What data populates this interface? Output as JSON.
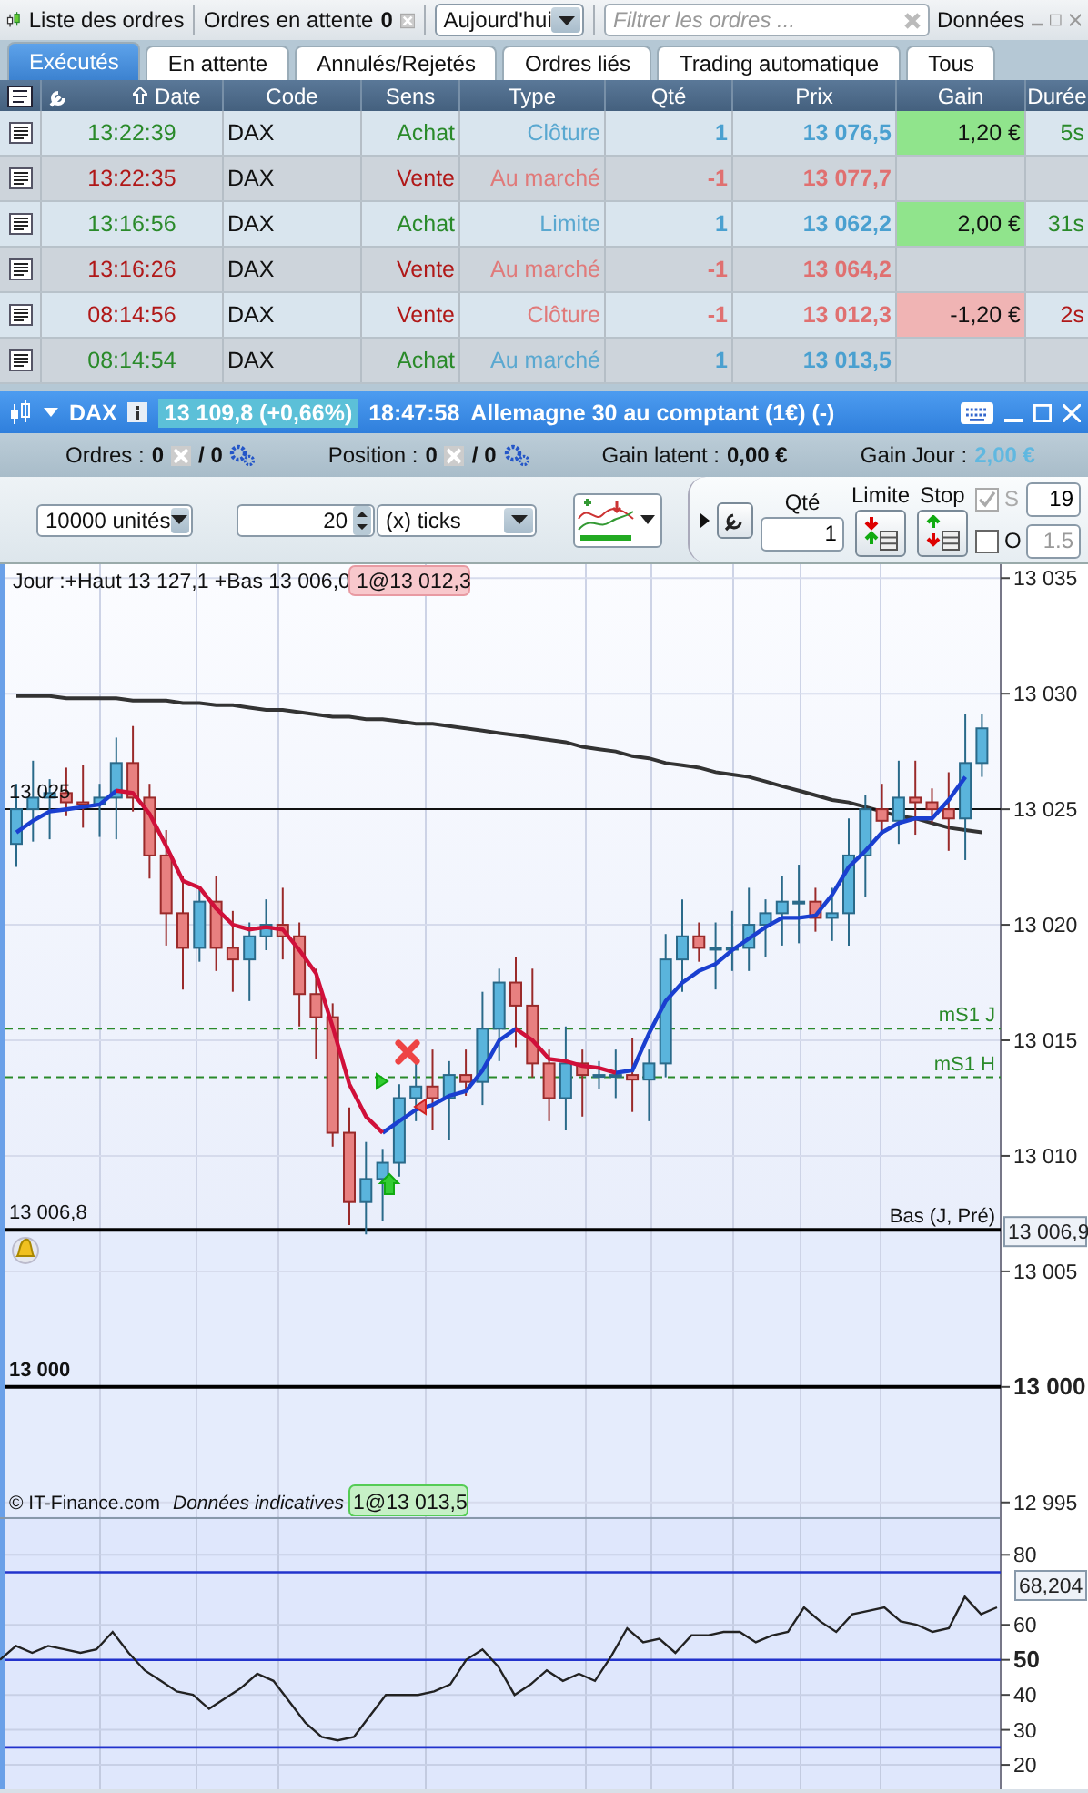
{
  "order_list": {
    "title": "Liste des ordres",
    "pending_label": "Ordres en attente",
    "pending_count": "0",
    "period": "Aujourd'hui",
    "filter": {
      "placeholder": "Filtrer les ordres ..."
    },
    "data_label": "Données",
    "tabs": [
      {
        "label": "Exécutés",
        "selected": true
      },
      {
        "label": "En attente",
        "selected": false
      },
      {
        "label": "Annulés/Rejetés",
        "selected": false
      },
      {
        "label": "Ordres liés",
        "selected": false
      },
      {
        "label": "Trading automatique",
        "selected": false
      },
      {
        "label": "Tous",
        "selected": false
      }
    ],
    "columns": [
      "Date",
      "Code",
      "Sens",
      "Type",
      "Qté",
      "Prix",
      "Gain",
      "Durée"
    ],
    "rows": [
      {
        "kind": "buy",
        "date": "13:22:39",
        "code": "DAX",
        "side": "Achat",
        "type": "Clôture",
        "qty": "1",
        "price": "13 076,5",
        "gain": "1,20 €",
        "gain_positive": true,
        "duration": "5s"
      },
      {
        "kind": "sell",
        "date": "13:22:35",
        "code": "DAX",
        "side": "Vente",
        "type": "Au marché",
        "qty": "-1",
        "price": "13 077,7"
      },
      {
        "kind": "buy",
        "date": "13:16:56",
        "code": "DAX",
        "side": "Achat",
        "type": "Limite",
        "qty": "1",
        "price": "13 062,2",
        "gain": "2,00 €",
        "gain_positive": true,
        "duration": "31s"
      },
      {
        "kind": "sell",
        "date": "13:16:26",
        "code": "DAX",
        "side": "Vente",
        "type": "Au marché",
        "qty": "-1",
        "price": "13 064,2"
      },
      {
        "kind": "sell",
        "date": "08:14:56",
        "code": "DAX",
        "side": "Vente",
        "type": "Clôture",
        "qty": "-1",
        "price": "13 012,3",
        "gain": "-1,20 €",
        "gain_positive": false,
        "duration": "2s"
      },
      {
        "kind": "buy",
        "date": "08:14:54",
        "code": "DAX",
        "side": "Achat",
        "type": "Au marché",
        "qty": "1",
        "price": "13 013,5"
      }
    ]
  },
  "chart_window": {
    "symbol": "DAX",
    "quote": "13 109,8 (+0,66%)",
    "time": "18:47:58",
    "instrument": "Allemagne 30 au comptant (1€) (-)"
  },
  "position_bar": {
    "orders_label": "Ordres :",
    "orders_count": "0",
    "orders_auto": "/ 0",
    "position_label": "Position :",
    "position_count": "0",
    "position_auto": "/ 0",
    "unrealized_label": "Gain latent :",
    "unrealized_value": "0,00 €",
    "day_gain_label": "Gain Jour :",
    "day_gain_value": "2,00 €"
  },
  "toolbar": {
    "units": "10000 unités",
    "step": "20",
    "step_unit": "(x) ticks",
    "qty_label": "Qté",
    "qty": "1",
    "limit_label": "Limite",
    "stop_label": "Stop",
    "s_label": "S",
    "s_checked": true,
    "s_value": "19",
    "o_label": "O",
    "o_checked": false,
    "o_value": "1.5"
  },
  "price_chart": {
    "header": "Jour :+Haut 13 127,1 +Bas 13 006,0",
    "sell_tag": "1@13 012,3",
    "buy_tag": "1@13 013,5",
    "current_price": "13 006,9",
    "low_line_name": "Bas (J, Pré)",
    "copyright": "© IT-Finance.com",
    "disclaimer": "Données indicatives",
    "chart_data": {
      "type": "candlestick",
      "grid": true,
      "ylim": [
        12994.4,
        13035.6
      ],
      "yticks": [
        {
          "value": 13035,
          "label": "13 035"
        },
        {
          "value": 13030,
          "label": "13 030"
        },
        {
          "value": 13025,
          "label": "13 025"
        },
        {
          "value": 13020,
          "label": "13 020"
        },
        {
          "value": 13015,
          "label": "13 015"
        },
        {
          "value": 13010,
          "label": "13 010"
        },
        {
          "value": 13005,
          "label": "13 005"
        },
        {
          "value": 13000,
          "label": "13 000"
        },
        {
          "value": 12995,
          "label": "12 995"
        }
      ],
      "ohlc": [
        [
          13023.5,
          13026.1,
          13022.5,
          13025
        ],
        [
          13025,
          13027.1,
          13023.6,
          13025.5
        ],
        [
          13025.5,
          13026.3,
          13023.7,
          13025.7
        ],
        [
          13025.7,
          13026.8,
          13024.7,
          13025.3
        ],
        [
          13025.3,
          13026.9,
          13024.2,
          13025.2
        ],
        [
          13025.2,
          13026.1,
          13023.8,
          13025.5
        ],
        [
          13025.5,
          13028.1,
          13023.7,
          13027
        ],
        [
          13027,
          13028.6,
          13024.9,
          13025.5
        ],
        [
          13025.5,
          13026.1,
          13022,
          13023
        ],
        [
          13023,
          13024.1,
          13019.1,
          13020.5
        ],
        [
          13020.5,
          13022.1,
          13017.2,
          13019
        ],
        [
          13019,
          13021.6,
          13018.4,
          13021
        ],
        [
          13021,
          13022.1,
          13018,
          13019
        ],
        [
          13019,
          13020.6,
          13017.1,
          13018.5
        ],
        [
          13018.5,
          13020.1,
          13016.7,
          13019.5
        ],
        [
          13019.5,
          13021.1,
          13018.9,
          13020
        ],
        [
          13020,
          13021.6,
          13018.5,
          13019.5
        ],
        [
          13019.5,
          13020.1,
          13015.6,
          13017
        ],
        [
          13017,
          13018.1,
          13014.2,
          13016
        ],
        [
          13016,
          13016.6,
          13010.4,
          13011
        ],
        [
          13011,
          13012.1,
          13007,
          13008
        ],
        [
          13008,
          13010.6,
          13006.6,
          13009
        ],
        [
          13009,
          13010.3,
          13007.2,
          13009.7
        ],
        [
          13009.7,
          13013.1,
          13009.1,
          13012.5
        ],
        [
          13012.5,
          13014.1,
          13011.5,
          13013
        ],
        [
          13013,
          13014.6,
          13011.1,
          13012.5
        ],
        [
          13012.5,
          13014.1,
          13010.7,
          13013.5
        ],
        [
          13013.5,
          13014.6,
          13012.6,
          13013.2
        ],
        [
          13013.2,
          13017.1,
          13012.2,
          13015.5
        ],
        [
          13015.5,
          13018.1,
          13014.1,
          13017.5
        ],
        [
          13017.5,
          13018.6,
          13014.7,
          13016.5
        ],
        [
          13016.5,
          13018.1,
          13013.4,
          13014
        ],
        [
          13014,
          13014.6,
          13011.5,
          13012.5
        ],
        [
          13012.5,
          13015.6,
          13011.1,
          13014
        ],
        [
          13014,
          13014.6,
          13011.7,
          13013.5
        ],
        [
          13013.5,
          13014.1,
          13012.9,
          13013.5
        ],
        [
          13013.5,
          13014.6,
          13012.5,
          13013.5
        ],
        [
          13013.5,
          13015.1,
          13011.9,
          13013.3
        ],
        [
          13013.3,
          13014.6,
          13011.5,
          13014
        ],
        [
          13014,
          13019.6,
          13013.4,
          13018.5
        ],
        [
          13018.5,
          13021.1,
          13017.1,
          13019.5
        ],
        [
          13019.5,
          13020.1,
          13018.4,
          13019
        ],
        [
          13019,
          13020.1,
          13017.2,
          13019
        ],
        [
          13019,
          13020.6,
          13018,
          13019
        ],
        [
          13019,
          13021.6,
          13018,
          13020
        ],
        [
          13020,
          13021.1,
          13018.6,
          13020.5
        ],
        [
          13020.5,
          13022.1,
          13019.1,
          13021
        ],
        [
          13021,
          13022.6,
          13019.2,
          13021
        ],
        [
          13021,
          13021.6,
          13019.7,
          13020.3
        ],
        [
          13020.3,
          13021.6,
          13019.3,
          13020.5
        ],
        [
          13020.5,
          13024.6,
          13019.1,
          13023
        ],
        [
          13023,
          13025.6,
          13021.2,
          13025
        ],
        [
          13025,
          13026.1,
          13023.9,
          13024.5
        ],
        [
          13024.5,
          13027.1,
          13023.5,
          13025.5
        ],
        [
          13025.5,
          13027.1,
          13023.9,
          13025.3
        ],
        [
          13025.3,
          13025.9,
          13024.4,
          13025
        ],
        [
          13025,
          13026.6,
          13023.2,
          13024.6
        ],
        [
          13024.6,
          13029.1,
          13022.8,
          13027
        ],
        [
          13027,
          13029.1,
          13026.4,
          13028.5
        ]
      ],
      "series": [
        {
          "type": "line",
          "color": "#333333",
          "values": [
            13029.9,
            13029.9,
            13029.9,
            13029.8,
            13029.8,
            13029.8,
            13029.8,
            13029.7,
            13029.7,
            13029.7,
            13029.6,
            13029.6,
            13029.5,
            13029.5,
            13029.4,
            13029.3,
            13029.3,
            13029.2,
            13029.1,
            13029.0,
            13029.0,
            13028.9,
            13028.9,
            13028.8,
            13028.7,
            13028.7,
            13028.6,
            13028.5,
            13028.4,
            13028.3,
            13028.2,
            13028.1,
            13028.0,
            13027.9,
            13027.7,
            13027.6,
            13027.5,
            13027.3,
            13027.2,
            13027.0,
            13026.9,
            13026.8,
            13026.6,
            13026.5,
            13026.4,
            13026.2,
            13026.0,
            13025.8,
            13025.6,
            13025.4,
            13025.3,
            13025.1,
            13024.9,
            13024.7,
            13024.6,
            13024.4,
            13024.2,
            13024.1,
            13024.0
          ]
        },
        {
          "type": "line",
          "color": "#1a3fd0",
          "values": [
            13024.0,
            13024.5,
            13024.9,
            13025.0,
            13025.1,
            13025.2,
            13025.8,
            null,
            null,
            null,
            null,
            null,
            null,
            null,
            null,
            null,
            null,
            null,
            null,
            null,
            null,
            null,
            13011.0,
            13011.5,
            13012.0,
            13012.2,
            13012.6,
            13012.8,
            13013.7,
            13015.0,
            13015.5,
            null,
            null,
            null,
            null,
            null,
            13013.6,
            13013.7,
            13015.3,
            13016.7,
            13017.5,
            13018.0,
            13018.3,
            13018.9,
            13019.4,
            13019.9,
            13020.3,
            13020.3,
            13020.4,
            13021.3,
            13022.5,
            13023.2,
            13024.0,
            13024.4,
            13024.6,
            13024.6,
            13025.4,
            13026.4,
            null
          ]
        },
        {
          "type": "line",
          "color": "#d0103a",
          "values": [
            null,
            null,
            null,
            null,
            null,
            null,
            13025.8,
            13025.7,
            13024.8,
            13023.4,
            13021.9,
            13021.6,
            13020.7,
            13020.0,
            13019.8,
            13019.9,
            13019.8,
            13018.9,
            13017.9,
            13015.6,
            13013.1,
            13011.7,
            13011.0,
            null,
            null,
            null,
            null,
            null,
            null,
            null,
            13015.5,
            13015.0,
            13014.2,
            13014.1,
            13013.9,
            13013.8,
            13013.6,
            null,
            null,
            null,
            null,
            null,
            null,
            null,
            null,
            null,
            null,
            null,
            null,
            null,
            null,
            null,
            null,
            null,
            null,
            null,
            null,
            null,
            null
          ]
        }
      ],
      "ref_lines": [
        {
          "axis": "y",
          "value": 13025,
          "label": "13 025",
          "color": "#111111"
        },
        {
          "axis": "y",
          "value": 13015.5,
          "label": "mS1 J",
          "color": "#2a8a2a"
        },
        {
          "axis": "y",
          "value": 13013.4,
          "label": "mS1 H",
          "color": "#2a8a2a"
        },
        {
          "axis": "y",
          "value": 13006.8,
          "label": "13 006,8",
          "color": "#000000"
        },
        {
          "axis": "y",
          "value": 13000,
          "label": "13 000",
          "color": "#000000"
        }
      ]
    }
  },
  "oscillator": {
    "current_value": "68,204",
    "chart_data": {
      "type": "line",
      "grid": true,
      "ylim": [
        13,
        91
      ],
      "yticks": [
        20,
        30,
        40,
        50,
        60,
        80
      ],
      "series": [
        {
          "color": "#222222",
          "values": [
            50,
            54,
            52,
            54,
            53,
            52,
            53,
            58,
            52,
            47,
            44,
            41,
            40,
            36,
            39,
            42,
            46,
            44,
            38,
            32,
            28,
            27,
            28,
            34,
            40,
            40,
            40,
            41,
            43,
            50,
            53,
            48,
            40,
            43,
            47,
            44,
            46,
            44,
            51,
            59,
            55,
            56,
            52,
            57,
            57,
            58,
            58,
            55,
            57,
            58,
            65,
            61,
            58,
            63,
            64,
            65,
            61,
            60,
            58,
            59,
            68,
            63,
            65
          ]
        }
      ],
      "ref_lines": [
        {
          "axis": "y",
          "value": 75,
          "color": "#2233cc"
        },
        {
          "axis": "y",
          "value": 50,
          "color": "#2233cc"
        },
        {
          "axis": "y",
          "value": 25,
          "color": "#2233cc"
        }
      ]
    }
  }
}
